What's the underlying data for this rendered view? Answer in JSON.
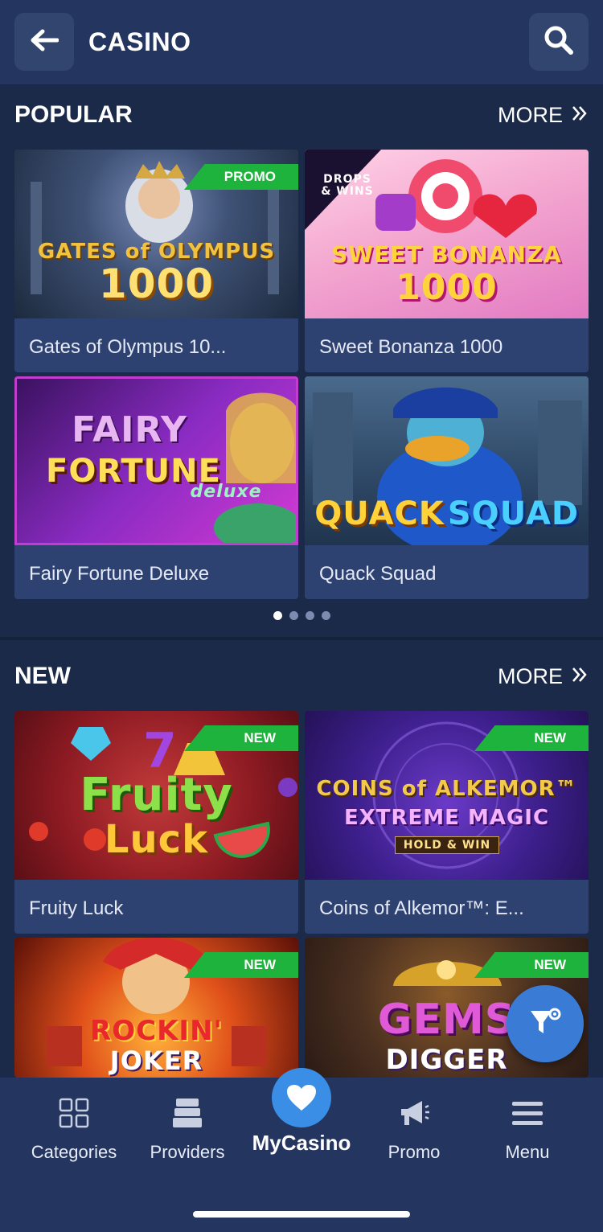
{
  "header": {
    "title": "CASINO",
    "back_icon": "arrow-left-icon",
    "search_icon": "search-icon"
  },
  "sections": [
    {
      "title": "POPULAR",
      "more_label": "MORE",
      "games": [
        {
          "name": "Gates of Olympus 10...",
          "badge": "PROMO",
          "art_line1": "GATES of OLYMPUS",
          "art_line2": "1000"
        },
        {
          "name": "Sweet Bonanza 1000",
          "badge": "",
          "art_tag": "DROPS & WINS",
          "art_line1": "SWEET BONANZA",
          "art_line2": "1000"
        },
        {
          "name": "Fairy Fortune Deluxe",
          "badge": "",
          "art_line1": "FAIRY",
          "art_line2": "FORTUNE",
          "art_line3": "deluxe"
        },
        {
          "name": "Quack Squad",
          "badge": "",
          "art_line1": "QUACK",
          "art_line2": "SQUAD"
        }
      ],
      "pager": {
        "count": 4,
        "active": 1
      }
    },
    {
      "title": "NEW",
      "more_label": "MORE",
      "games": [
        {
          "name": "Fruity Luck",
          "badge": "NEW",
          "art_line1": "Fruity",
          "art_line2": "Luck"
        },
        {
          "name": "Coins of Alkemor™: E...",
          "badge": "NEW",
          "art_line1": "COINS of ALKEMOR™",
          "art_line2": "EXTREME MAGIC",
          "art_line3": "HOLD & WIN"
        },
        {
          "name": "",
          "badge": "NEW",
          "art_line1": "ROCKIN'",
          "art_line2": "JOKER"
        },
        {
          "name": "",
          "badge": "NEW",
          "art_line1": "GEMS",
          "art_line2": "DIGGER"
        }
      ]
    }
  ],
  "fab": {
    "icon": "filter-settings-icon"
  },
  "bottom_nav": [
    {
      "label": "Categories",
      "icon": "grid-icon"
    },
    {
      "label": "Providers",
      "icon": "stack-icon"
    },
    {
      "label": "MyCasino",
      "icon": "heart-icon"
    },
    {
      "label": "Promo",
      "icon": "megaphone-icon"
    },
    {
      "label": "Menu",
      "icon": "hamburger-icon"
    }
  ],
  "colors": {
    "background": "#1c2a4a",
    "header": "#243560",
    "tile": "#2e4272",
    "badge_green": "#1db33c",
    "accent_blue": "#3a8ee6"
  }
}
